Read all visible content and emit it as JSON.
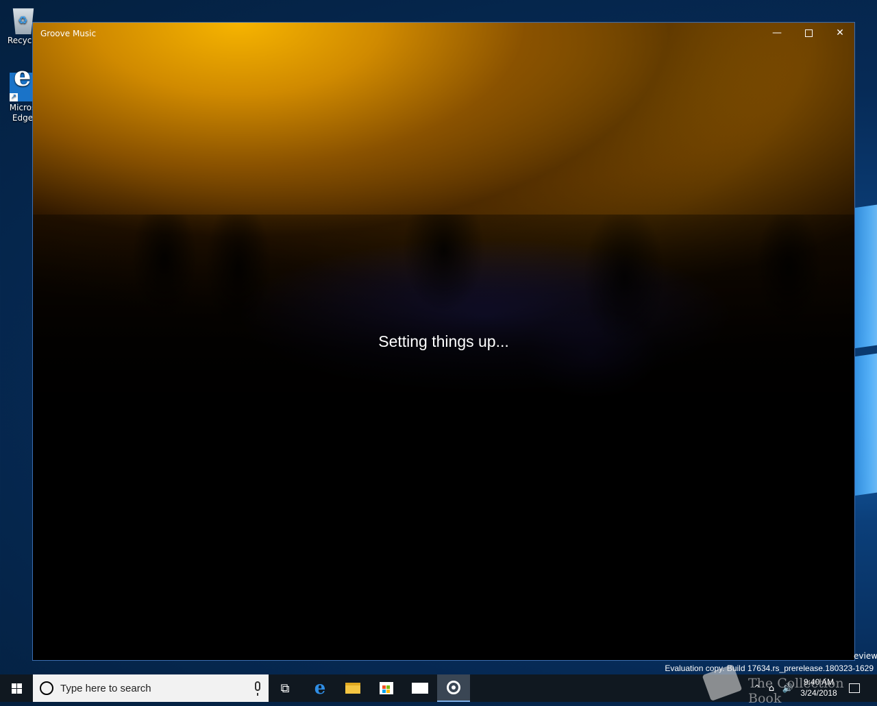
{
  "desktop": {
    "icons": [
      {
        "label": "Recycle Bin",
        "visible_label": "Recycle"
      },
      {
        "label": "Microsoft Edge",
        "line1": "Micros",
        "line2": "Edge"
      }
    ],
    "watermark_preview": "eview",
    "watermark_build": "Evaluation copy. Build 17634.rs_prerelease.180323-1629"
  },
  "window": {
    "title": "Groove Music",
    "status_text": "Setting things up...",
    "buttons": {
      "minimize": "—",
      "close": "✕"
    }
  },
  "taskbar": {
    "search_placeholder": "Type here to search",
    "taskview_glyph": "⧉",
    "edge_glyph": "e",
    "tray_up_glyph": "^",
    "tray_net_glyph": "⌂",
    "tray_vol_glyph": "🔊",
    "clock": {
      "time": "9:40 AM",
      "date": "3/24/2018"
    }
  },
  "overlay": {
    "brand": "The Collection Book"
  },
  "colors": {
    "desktop_blue": "#062a56",
    "taskbar": "#101820",
    "window_border": "#3b6fb4",
    "glow_orange": "#f6b400"
  }
}
